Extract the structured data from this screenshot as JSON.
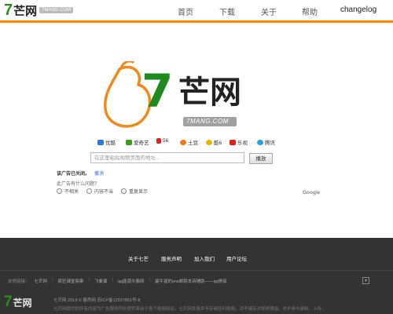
{
  "header": {
    "logo_mark": "7",
    "logo_text": "芒网",
    "logo_domain": "7MANG.COM",
    "nav": [
      "首页",
      "下载",
      "关于",
      "帮助",
      "changelog"
    ],
    "accent_color": "#ff8a00"
  },
  "main_logo": {
    "mark": "7",
    "text": "芒网",
    "domain": "7MANG.COM"
  },
  "sites": [
    {
      "label": "优酷",
      "icon": "youku-icon",
      "color": "#2a7bd4"
    },
    {
      "label": "爱奇艺",
      "icon": "iqiyi-icon",
      "color": "#3c9b1f"
    },
    {
      "label": "56",
      "icon": "56-icon",
      "color": "#e02020"
    },
    {
      "label": "土豆",
      "icon": "tudou-icon",
      "color": "#f07a1c"
    },
    {
      "label": "酷6",
      "icon": "ku6-icon",
      "color": "#e6b800"
    },
    {
      "label": "乐视",
      "icon": "letv-icon",
      "color": "#e02020"
    },
    {
      "label": "腾讯",
      "icon": "tencent-icon",
      "color": "#2aa0e0"
    }
  ],
  "search": {
    "placeholder": "在这里粘贴视频页面的地址...",
    "button_label": "播放"
  },
  "ad": {
    "closed_text": "该广告已关闭。",
    "undo_link": "撤消",
    "question": "此广告有什么问题？",
    "options": [
      "不相关",
      "内容不当",
      "重复显示"
    ],
    "brand": "Google"
  },
  "footer": {
    "links": [
      "关于七芒",
      "服务声明",
      "加入我们",
      "用户论坛"
    ],
    "friends_label": "友情链接：",
    "friends": [
      "七芒网",
      "疯狂课堂简案",
      "飞禽谱",
      "qq能源头像网",
      "最牛逼的sns邮局本诗辅助——qq情侣"
    ],
    "copyright": "七芒网 2014 © 春然网 苏ICP备12027851号-8",
    "description": "七芒网提供的所有内容为广告服务同步提供来自于各个视频网站，七芒网本身并不存储任何视频，并不储存对视频筛选，也不参与录制、上传。"
  }
}
